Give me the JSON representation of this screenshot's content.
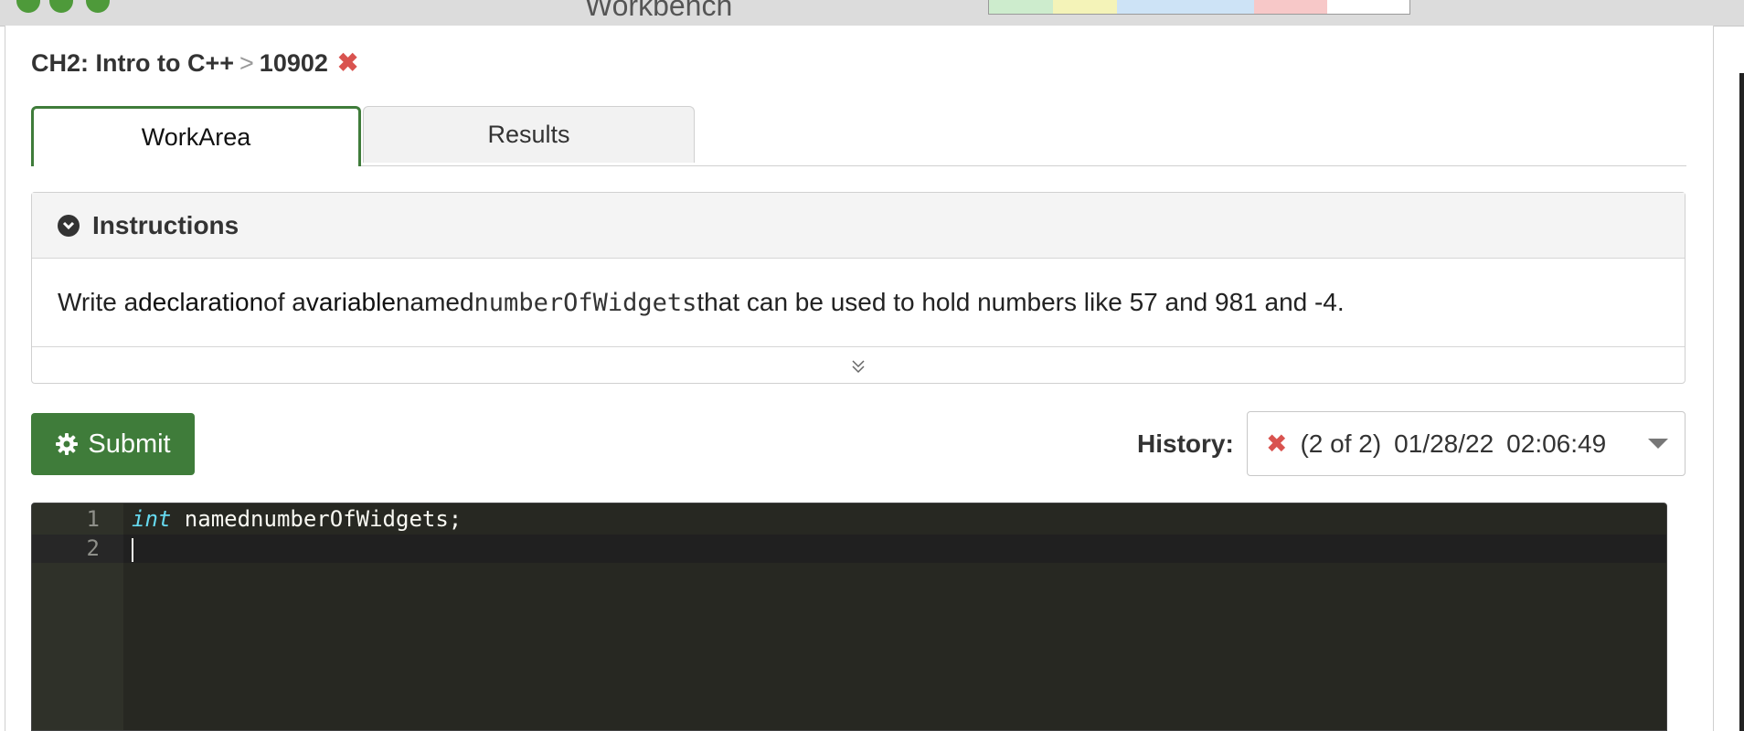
{
  "window": {
    "title": "Workbench"
  },
  "score_strip": {
    "colors": [
      "#cdeccd",
      "#f4f3b8",
      "#cde3f6",
      "#cde3f6",
      "#f7c8c8",
      "#ffffff"
    ]
  },
  "breadcrumb": {
    "course": "CH2: Intro to C++",
    "separator": ">",
    "exercise_id": "10902",
    "status_icon": "close-icon",
    "status_color": "#d9534f"
  },
  "tabs": [
    {
      "label": "WorkArea",
      "active": true
    },
    {
      "label": "Results",
      "active": false
    }
  ],
  "instructions": {
    "title": "Instructions",
    "text_parts": {
      "p1": "Write a ",
      "p2": "declaration",
      "p3": " of a ",
      "p4": "variable",
      "p5": " named",
      "p6": "numberOfWidgets",
      "p7": " that can be used to hold numbers like 57 and 981 and -4."
    }
  },
  "submit": {
    "label": "Submit",
    "icon": "gear-icon",
    "color": "#3f7c3a"
  },
  "history": {
    "label": "History:",
    "status_icon": "close-icon",
    "count": "(2 of 2)",
    "date": "01/28/22",
    "time": "02:06:49"
  },
  "editor": {
    "lines": [
      {
        "number": "1",
        "keyword": "int",
        "rest": " namednumberOfWidgets;"
      },
      {
        "number": "2",
        "keyword": "",
        "rest": ""
      }
    ]
  }
}
